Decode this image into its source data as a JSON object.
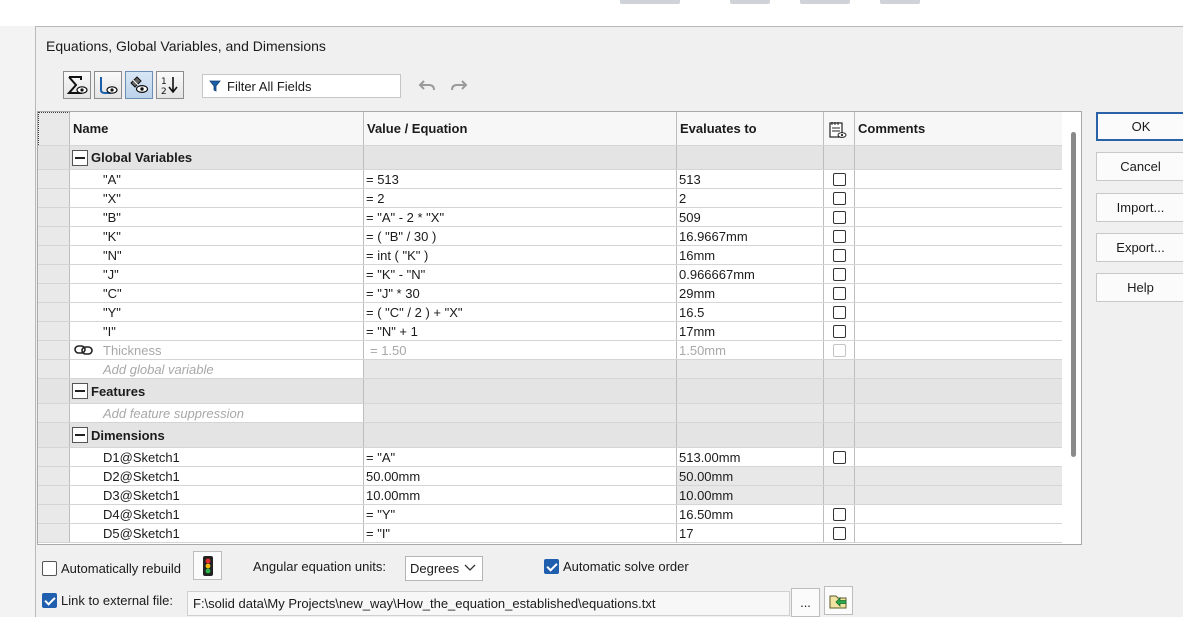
{
  "dialog": {
    "title": "Equations, Global Variables, and Dimensions"
  },
  "toolbar": {
    "buttons": [
      {
        "name": "equation-view",
        "icon": "sigma-eye-icon",
        "active": false
      },
      {
        "name": "sketch-equation-view",
        "icon": "sketch-eye-icon",
        "active": false
      },
      {
        "name": "dimension-view",
        "icon": "dimension-eye-icon",
        "active": true
      },
      {
        "name": "ordered-view",
        "icon": "sort-order-icon",
        "active": false
      }
    ],
    "filter_placeholder": "Filter All Fields",
    "undo_icon": "undo-icon",
    "redo_icon": "redo-icon"
  },
  "grid": {
    "columns": [
      "Name",
      "Value / Equation",
      "Evaluates to",
      "",
      "Comments"
    ],
    "comment_col_icon": "notepad-icon",
    "sections": {
      "global": "Global Variables",
      "features": "Features",
      "dimensions": "Dimensions"
    },
    "global_rows": [
      {
        "name": "\"A\"",
        "value": "= 513",
        "evaluates": "513"
      },
      {
        "name": "\"X\"",
        "value": "= 2",
        "evaluates": "2"
      },
      {
        "name": "\"B\"",
        "value": "= \"A\" - 2 * \"X\"",
        "evaluates": "509"
      },
      {
        "name": "\"K\"",
        "value": "= ( \"B\" / 30 )",
        "evaluates": "16.9667mm"
      },
      {
        "name": "\"N\"",
        "value": "= int ( \"K\" )",
        "evaluates": "16mm"
      },
      {
        "name": "\"J\"",
        "value": "= \"K\" - \"N\"",
        "evaluates": "0.966667mm"
      },
      {
        "name": "\"C\"",
        "value": "= \"J\" * 30",
        "evaluates": "29mm"
      },
      {
        "name": "\"Y\"",
        "value": "= ( \"C\" / 2 ) + \"X\"",
        "evaluates": "16.5"
      },
      {
        "name": "\"I\"",
        "value": "= \"N\" + 1",
        "evaluates": "17mm"
      }
    ],
    "linked_row": {
      "name": "Thickness",
      "value": "= 1.50",
      "evaluates": "1.50mm",
      "icon": "link-icon"
    },
    "add_global": "Add global variable",
    "add_feature": "Add feature suppression",
    "dimension_rows": [
      {
        "name": "D1@Sketch1",
        "value": "= \"A\"",
        "evaluates": "513.00mm",
        "check": true
      },
      {
        "name": "D2@Sketch1",
        "value": "50.00mm",
        "evaluates": "50.00mm",
        "check": false
      },
      {
        "name": "D3@Sketch1",
        "value": "10.00mm",
        "evaluates": "10.00mm",
        "check": false
      },
      {
        "name": "D4@Sketch1",
        "value": "= \"Y\"",
        "evaluates": "16.50mm",
        "check": true
      },
      {
        "name": "D5@Sketch1",
        "value": "= \"I\"",
        "evaluates": "17",
        "check": true
      }
    ]
  },
  "buttons": {
    "ok": "OK",
    "cancel": "Cancel",
    "import": "Import...",
    "export": "Export...",
    "help": "Help"
  },
  "bottom": {
    "auto_rebuild": "Automatically rebuild",
    "auto_rebuild_checked": false,
    "rebuild_icon": "traffic-light-icon",
    "angular_label": "Angular equation units:",
    "angular_value": "Degrees",
    "auto_solve": "Automatic solve order",
    "auto_solve_checked": true,
    "link_label": "Link to external file:",
    "link_checked": true,
    "file_path": "F:\\solid data\\My Projects\\new_way\\How_the_equation_established\\equations.txt",
    "browse": "...",
    "open_file_icon": "open-file-icon"
  }
}
